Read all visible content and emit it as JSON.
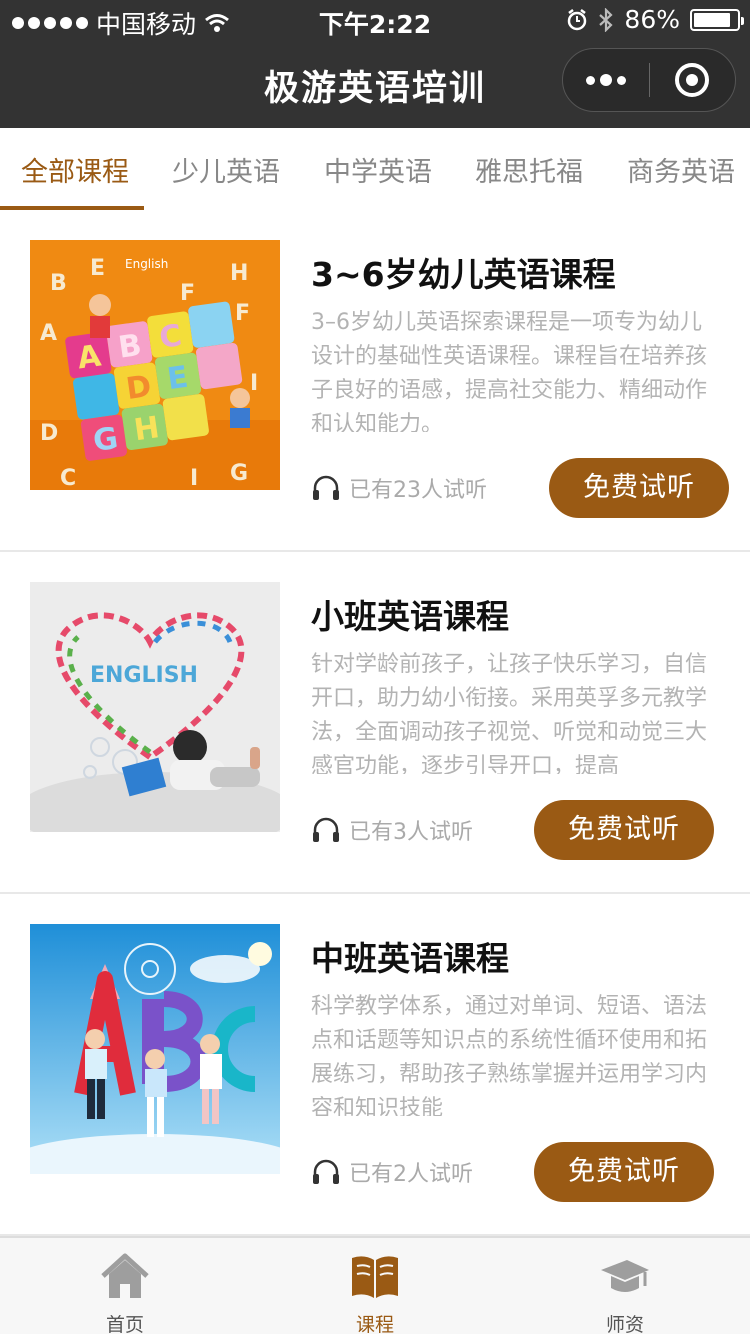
{
  "status_bar": {
    "carrier": "中国移动",
    "time": "下午2:22",
    "battery": "86%",
    "battery_level": 0.86
  },
  "nav": {
    "title": "极游英语培训"
  },
  "tabs": [
    {
      "label": "全部课程",
      "active": true
    },
    {
      "label": "少儿英语",
      "active": false
    },
    {
      "label": "中学英语",
      "active": false
    },
    {
      "label": "雅思托福",
      "active": false
    },
    {
      "label": "商务英语",
      "active": false
    }
  ],
  "courses": [
    {
      "title": "3~6岁幼儿英语课程",
      "description": "3–6岁幼儿英语探索课程是一项专为幼儿设计的基础性英语课程。课程旨在培养孩子良好的语感，提高社交能力、精细动作和认知能力。",
      "trial": "已有23人试听",
      "button": "免费试听",
      "image_letters": [
        "E",
        "n",
        "g",
        "l",
        "i",
        "s",
        "h"
      ]
    },
    {
      "title": "小班英语课程",
      "description": "针对学龄前孩子，让孩子快乐学习，自信开口，助力幼小衔接。采用英孚多元教学法，全面调动孩子视觉、听觉和动觉三大感官功能，逐步引导开口，提高",
      "trial": "已有3人试听",
      "button": "免费试听",
      "image_letters": [
        "E",
        "N",
        "G",
        "L",
        "I",
        "S",
        "H"
      ]
    },
    {
      "title": "中班英语课程",
      "description": "科学教学体系，通过对单词、短语、语法点和话题等知识点的系统性循环使用和拓展练习，帮助孩子熟练掌握并运用学习内容和知识技能",
      "trial": "已有2人试听",
      "button": "免费试听",
      "image_letters": [
        "A",
        "B",
        "C"
      ]
    }
  ],
  "tabbar": [
    {
      "label": "首页",
      "icon": "home-icon",
      "active": false
    },
    {
      "label": "课程",
      "icon": "book-icon",
      "active": true
    },
    {
      "label": "师资",
      "icon": "graduation-cap-icon",
      "active": false
    }
  ],
  "colors": {
    "accent": "#9a5a14",
    "bar": "#333333",
    "muted_text": "#b3b3b3"
  }
}
